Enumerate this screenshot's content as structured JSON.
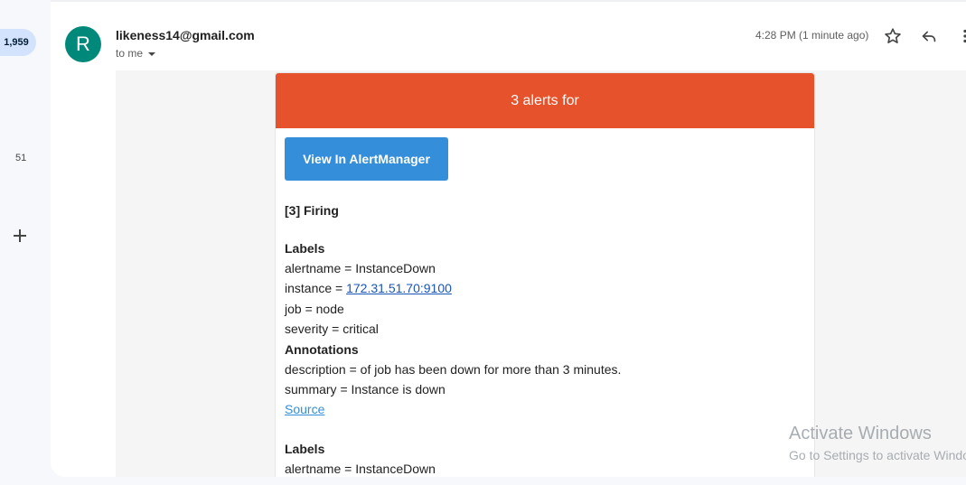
{
  "rail": {
    "inbox_count": "1,959",
    "secondary_count": "51"
  },
  "message": {
    "avatar_letter": "R",
    "sender": "likeness14@gmail.com",
    "to": "to me",
    "timestamp": "4:28 PM (1 minute ago)"
  },
  "alert": {
    "header": "3 alerts for",
    "button_label": "View In AlertManager",
    "firing": "[3] Firing",
    "labels_title": "Labels",
    "alertname": "alertname = InstanceDown",
    "instance_prefix": "instance = ",
    "instance_link": "172.31.51.70:9100",
    "job": "job = node",
    "severity": "severity = critical",
    "annotations_title": "Annotations",
    "description": "description = of job has been down for more than 3 minutes.",
    "summary": "summary = Instance is down",
    "source_link": "Source",
    "labels_title_2": "Labels",
    "alertname_2": "alertname = InstanceDown"
  },
  "watermark": {
    "title": "Activate Windows",
    "subtitle": "Go to Settings to activate Windows."
  },
  "colors": {
    "alert_header": "#e6522c",
    "button": "#348eda",
    "avatar": "#00897b"
  }
}
